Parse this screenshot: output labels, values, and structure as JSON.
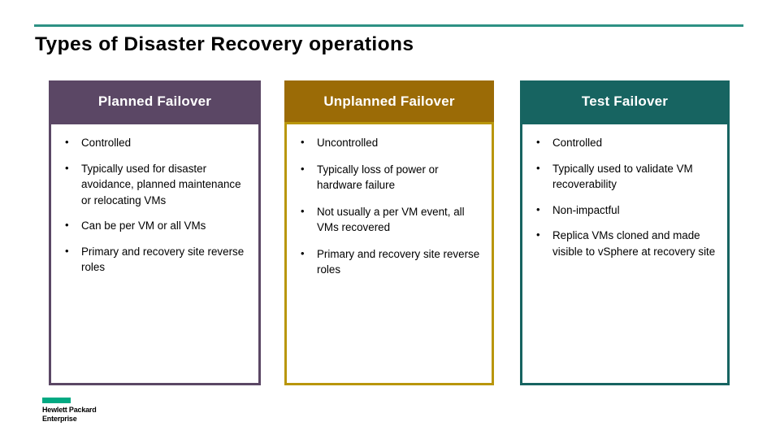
{
  "slide": {
    "title": "Types of Disaster Recovery operations",
    "accent_rule_color": "#2d9184"
  },
  "columns": [
    {
      "id": "planned-failover",
      "header": "Planned Failover",
      "header_bg": "#5b4765",
      "border_color": "#5b4765",
      "bullets": [
        "Controlled",
        "Typically used for disaster avoidance, planned maintenance or relocating VMs",
        "Can be per VM or all VMs",
        "Primary and recovery site reverse roles"
      ]
    },
    {
      "id": "unplanned-failover",
      "header": "Unplanned Failover",
      "header_bg": "#9b6b06",
      "border_color": "#b9960c",
      "bullets": [
        "Uncontrolled",
        "Typically loss of power or hardware failure",
        "Not usually a per VM event, all VMs recovered",
        "Primary and recovery site reverse roles"
      ]
    },
    {
      "id": "test-failover",
      "header": "Test Failover",
      "header_bg": "#176461",
      "border_color": "#176461",
      "bullets": [
        "Controlled",
        "Typically used to validate VM recoverability",
        "Non-impactful",
        "Replica VMs cloned and made visible to vSphere at recovery site"
      ]
    }
  ],
  "logo": {
    "line1": "Hewlett Packard",
    "line2": "Enterprise",
    "bar_color": "#01a982"
  }
}
